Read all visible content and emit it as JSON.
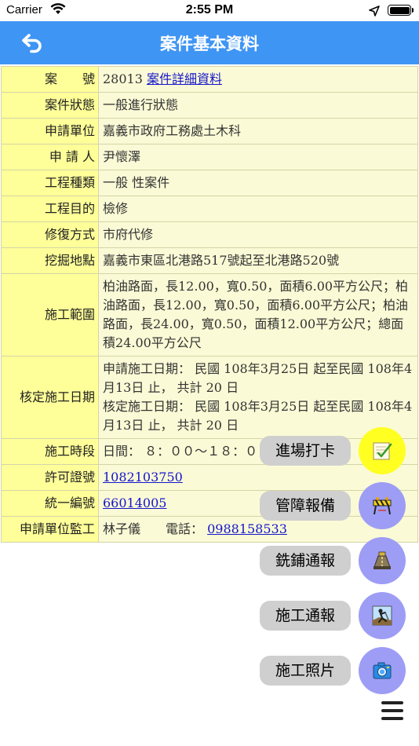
{
  "status_bar": {
    "carrier": "Carrier",
    "time": "2:55 PM"
  },
  "navbar": {
    "title": "案件基本資料",
    "back_icon": "back-arrow-icon"
  },
  "table": {
    "rows": [
      {
        "label": "案　　號",
        "value": "28013 ",
        "link": "案件詳細資料"
      },
      {
        "label": "案件狀態",
        "value": "一般進行狀態"
      },
      {
        "label": "申請單位",
        "value": "嘉義市政府工務處土木科"
      },
      {
        "label": "申 請 人",
        "value": "尹懷澤"
      },
      {
        "label": "工程種類",
        "value": "一般 性案件"
      },
      {
        "label": "工程目的",
        "value": "檢修"
      },
      {
        "label": "修復方式",
        "value": "市府代修"
      },
      {
        "label": "挖掘地點",
        "value": "嘉義市東區北港路517號起至北港路520號"
      },
      {
        "label": "施工範圍",
        "value": "柏油路面，長12.00，寬0.50，面積6.00平方公尺；柏油路面，長12.00，寬0.50，面積6.00平方公尺；柏油路面，長24.00，寬0.50，面積12.00平方公尺；總面積24.00平方公尺"
      },
      {
        "label": "核定施工日期",
        "value": "申請施工日期： 民國 108年3月25日 起至民國 108年4月13日 止， 共計 20 日",
        "value2": "核定施工日期： 民國 108年3月25日 起至民國 108年4月13日 止， 共計 20 日"
      },
      {
        "label": "施工時段",
        "value": "日間： ８：００～１８：００；"
      },
      {
        "label": "許可證號",
        "link": "1082103750"
      },
      {
        "label": "統一編號",
        "link": "66014005"
      },
      {
        "label": "申請單位監工",
        "value": "林子儀　　電話： ",
        "link": "0988158533"
      }
    ]
  },
  "fab_menu": {
    "items": [
      {
        "label": "進場打卡",
        "icon": "check-in-icon",
        "color": "#ffff22"
      },
      {
        "label": "管障報備",
        "icon": "barrier-report-icon",
        "color": "#9d9df6"
      },
      {
        "label": "銑鋪通報",
        "icon": "milling-paving-icon",
        "color": "#9d9df6"
      },
      {
        "label": "施工通報",
        "icon": "construction-worker-icon",
        "color": "#9d9df6"
      },
      {
        "label": "施工照片",
        "icon": "camera-icon",
        "color": "#9d9df6"
      }
    ],
    "toggle_icon": "hamburger-menu-icon"
  }
}
